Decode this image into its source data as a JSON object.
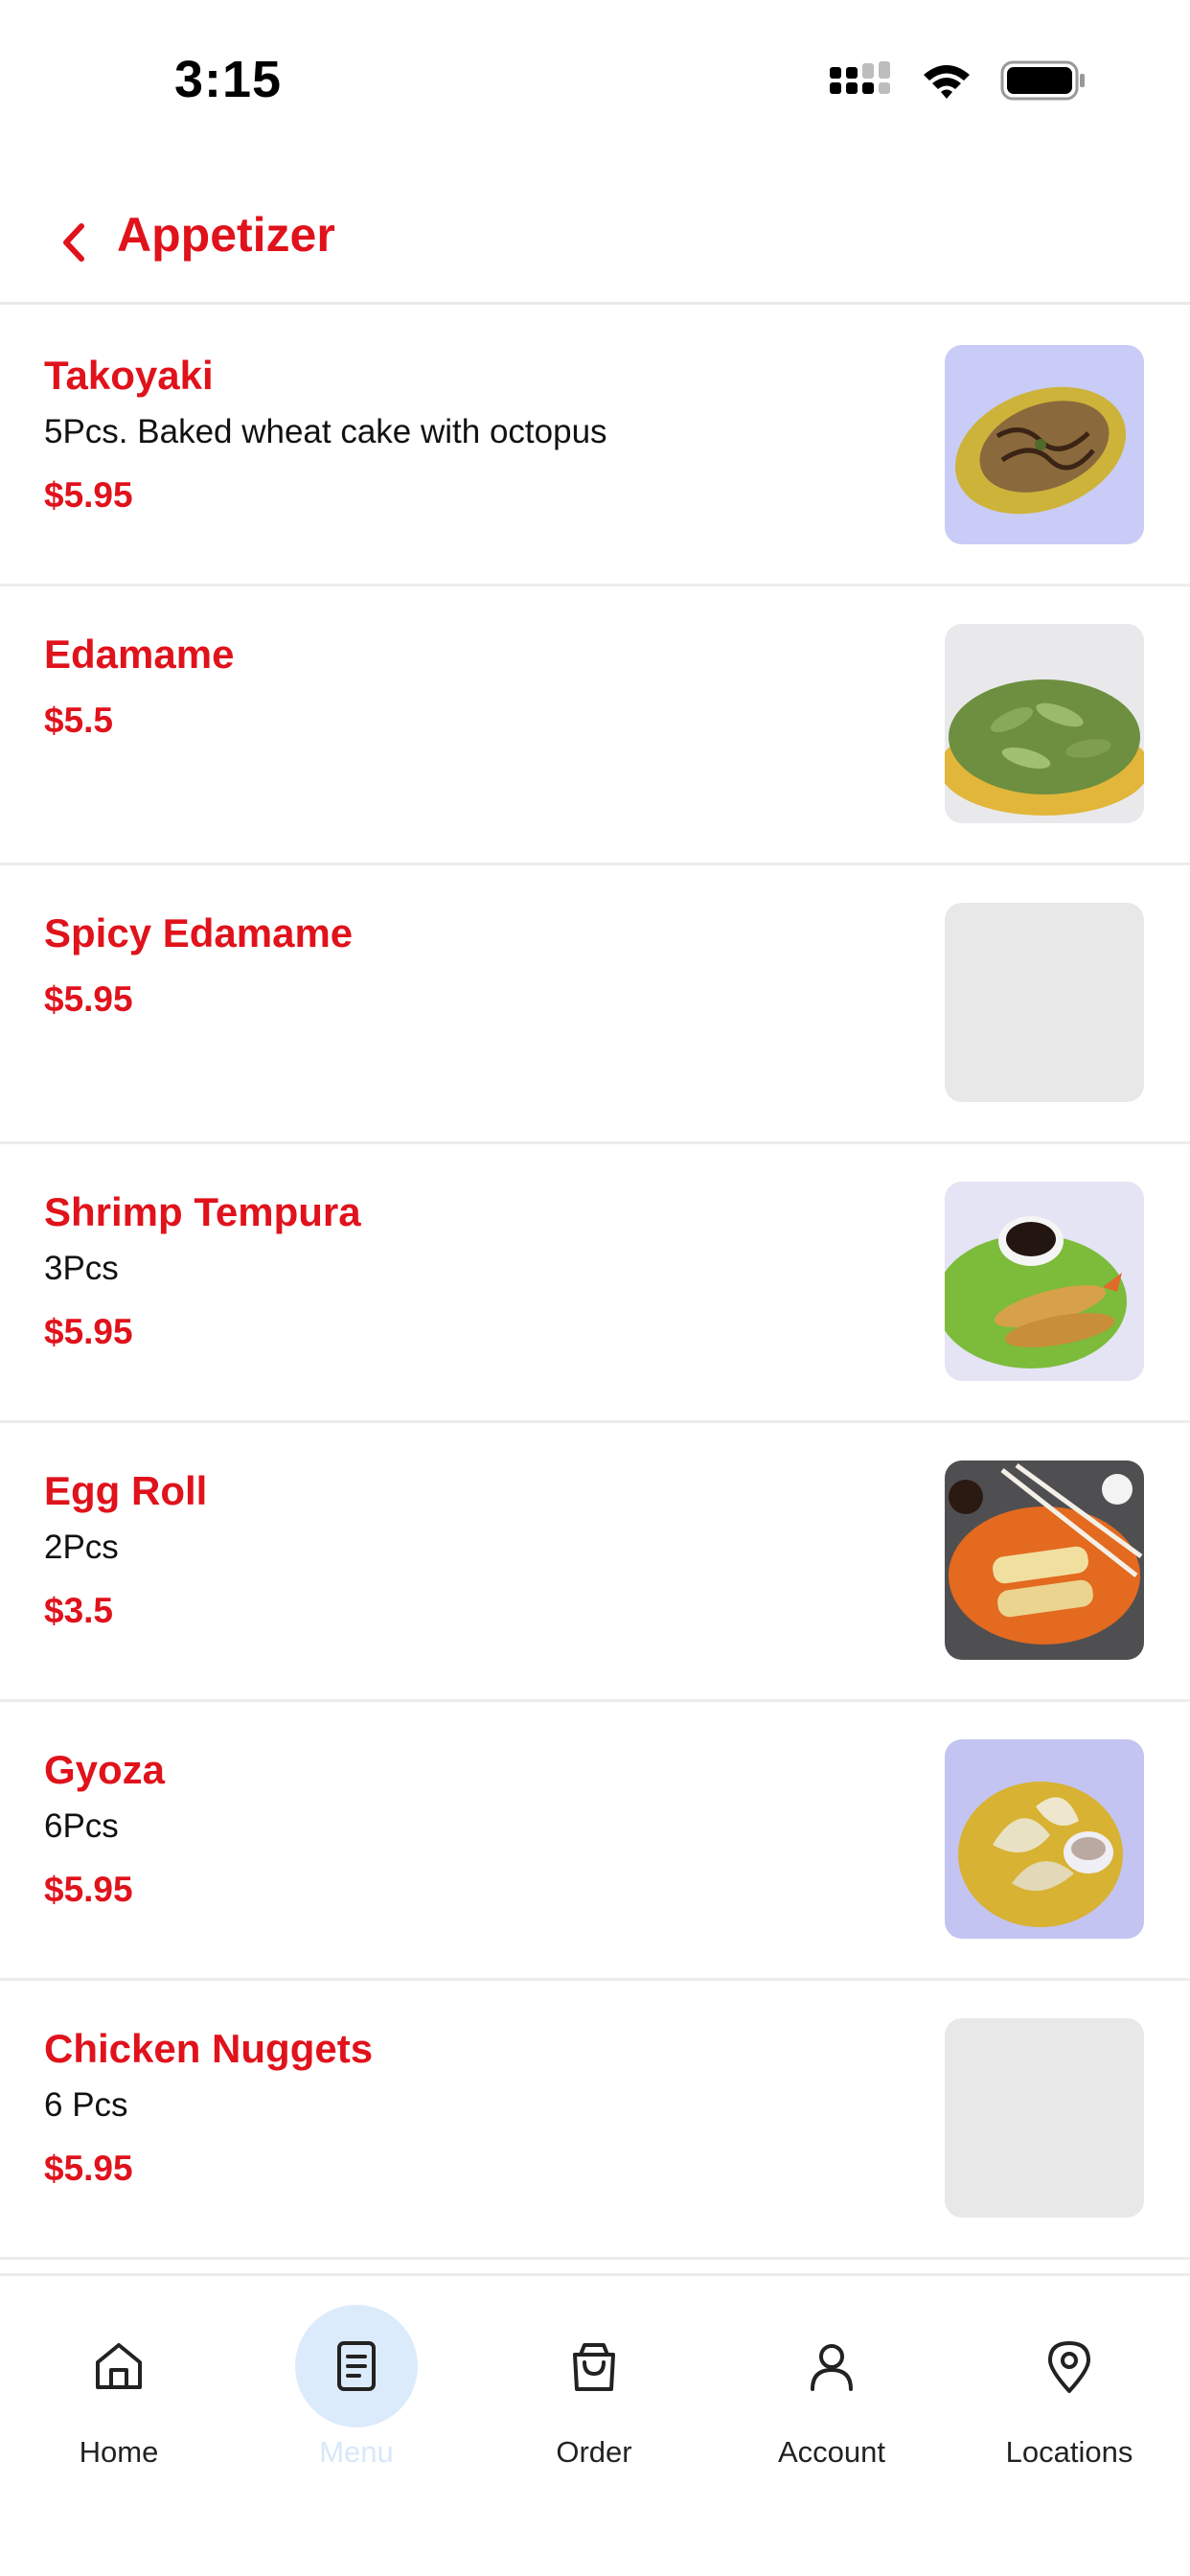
{
  "status_bar": {
    "time": "3:15"
  },
  "header": {
    "title": "Appetizer"
  },
  "items": [
    {
      "name": "Takoyaki",
      "description": "5Pcs. Baked wheat cake with octopus",
      "price": "$5.95",
      "image": "takoyaki"
    },
    {
      "name": "Edamame",
      "description": "",
      "price": "$5.5",
      "image": "edamame"
    },
    {
      "name": "Spicy Edamame",
      "description": "",
      "price": "$5.95",
      "image": "placeholder"
    },
    {
      "name": "Shrimp Tempura",
      "description": "3Pcs",
      "price": "$5.95",
      "image": "shrimp-tempura"
    },
    {
      "name": "Egg Roll",
      "description": "2Pcs",
      "price": "$3.5",
      "image": "egg-roll"
    },
    {
      "name": "Gyoza",
      "description": "6Pcs",
      "price": "$5.95",
      "image": "gyoza"
    },
    {
      "name": "Chicken Nuggets",
      "description": "6 Pcs",
      "price": "$5.95",
      "image": "placeholder"
    }
  ],
  "nav": {
    "active": "menu",
    "items": [
      {
        "id": "home",
        "label": "Home",
        "icon": "home-icon"
      },
      {
        "id": "menu",
        "label": "Menu",
        "icon": "menu-icon"
      },
      {
        "id": "order",
        "label": "Order",
        "icon": "bag-icon"
      },
      {
        "id": "account",
        "label": "Account",
        "icon": "user-icon"
      },
      {
        "id": "locations",
        "label": "Locations",
        "icon": "location-pin-icon"
      }
    ]
  },
  "colors": {
    "brand": "#e0121b",
    "active_nav": "#dcebfb",
    "divider": "#ececec"
  }
}
